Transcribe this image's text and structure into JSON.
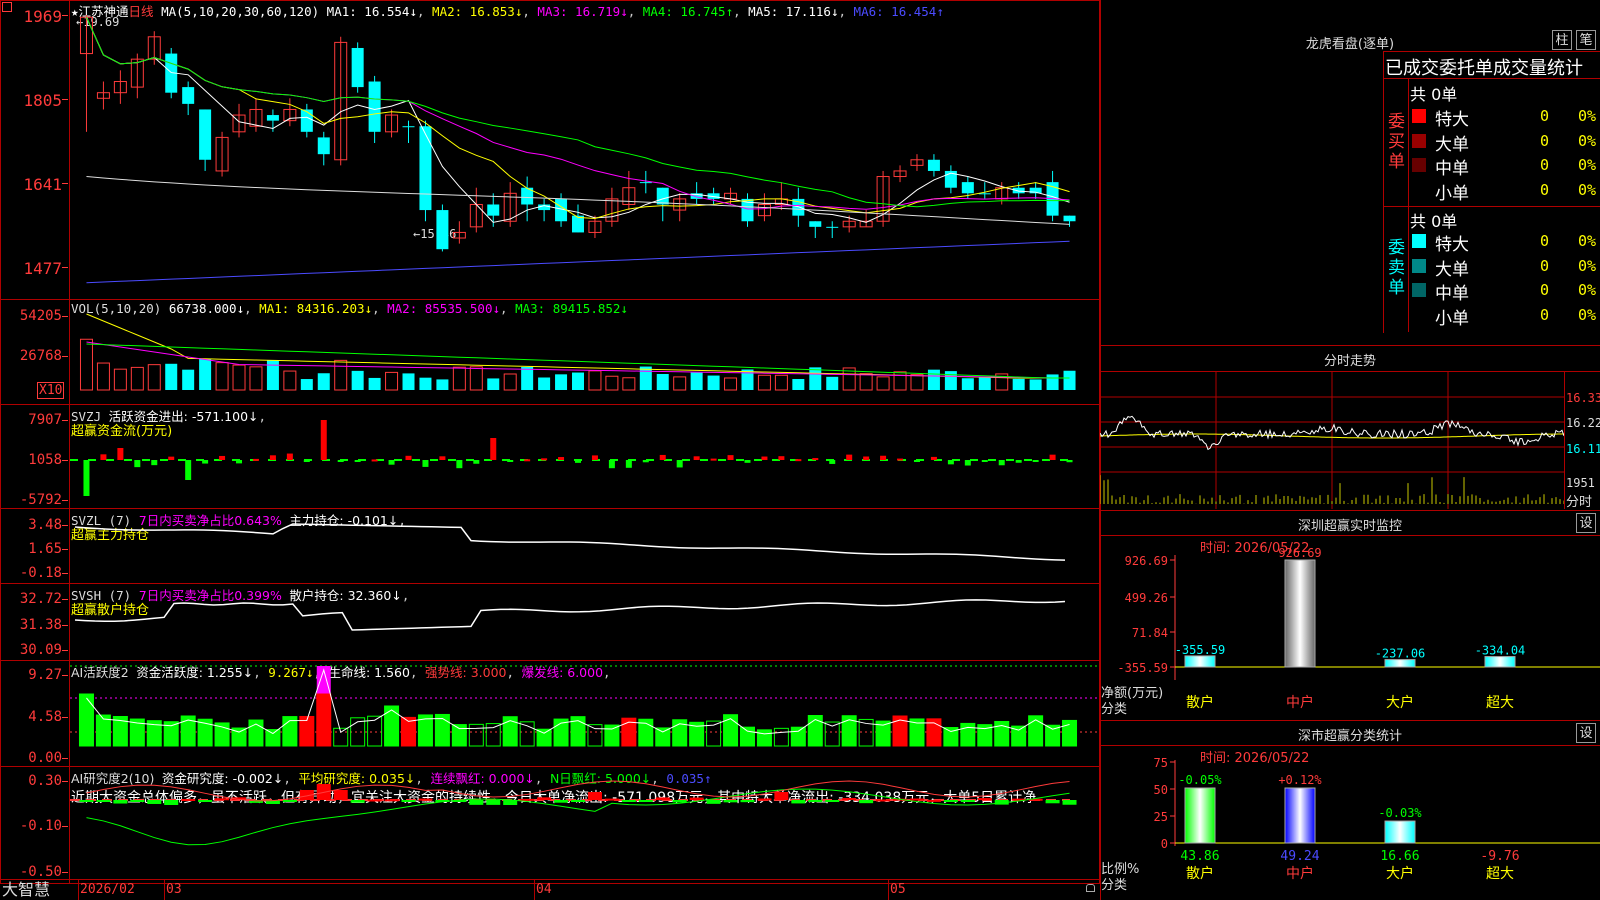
{
  "stock": {
    "star": "★",
    "name": "江苏神通",
    "period": "日线",
    "ma_header": "MA(5,10,20,30,60,120)",
    "ma": [
      {
        "label": "MA1: 16.554↓",
        "color": "#ffffff"
      },
      {
        "label": "MA2: 16.853↓",
        "color": "#ffff00"
      },
      {
        "label": "MA3: 16.719↓",
        "color": "#ff00ff"
      },
      {
        "label": "MA4: 16.745↑",
        "color": "#00ff00"
      },
      {
        "label": "MA5: 17.116↓",
        "color": "#ffffff"
      },
      {
        "label": "MA6: 16.454↑",
        "color": "#4b4bff"
      }
    ],
    "top_left_icon": "expand-icon",
    "high_mark": "←19.69",
    "low_mark": "←15.46"
  },
  "price_axis": [
    "1969",
    "1805",
    "1641",
    "1477"
  ],
  "vol": {
    "header": "VOL(5,10,20)",
    "value": "66738.000↓",
    "ma1": "MA1: 84316.203↓",
    "ma2": "MA2: 85535.500↓",
    "ma3": "MA3: 89415.852↓",
    "axis": [
      "54205",
      "26768"
    ],
    "unit": "X10"
  },
  "svzj": {
    "header": "SVZJ",
    "label": "活跃资金进出: -571.100↓",
    "sub": "超赢资金流(万元)",
    "axis": [
      "7907",
      "1058",
      "-5792"
    ]
  },
  "svzl": {
    "header": "SVZL (7)",
    "ratio": "7日内买卖净占比0.643%",
    "label": "主力持仓: -0.101↓",
    "sub": "超赢主力持仓",
    "axis": [
      "3.48",
      "1.65",
      "-0.18"
    ]
  },
  "svsh": {
    "header": "SVSH (7)",
    "ratio": "7日内买卖净占比0.399%",
    "label": "散户持仓: 32.360↓",
    "sub": "超赢散户持仓",
    "axis": [
      "32.72",
      "31.38",
      "30.09"
    ]
  },
  "ai1": {
    "header": "AI活跃度2",
    "label": "资金活跃度: 1.255↓",
    "v2": "9.267↓",
    "life": "生命线: 1.560",
    "strong": "强势线: 3.000",
    "burst": "爆发线: 6.000",
    "axis": [
      "9.27",
      "4.58",
      "0.00"
    ]
  },
  "ai2": {
    "header": "AI研究度2(10)",
    "label": "资金研究度: -0.002↓",
    "avg": "平均研究度: 0.035↓",
    "cont": "连续飘红: 0.000↓",
    "nday": "N日飘红: 5.000↓",
    "last": "0.035↑",
    "comment": "近期大资金总体偏多，虽不活跃，但有异动，宜关注大资金的持续性，今日大单净流出: -571.098万元，其中特大单净流出: -334.038万元，大单5日累计净",
    "axis": [
      "0.30",
      "-0.10",
      "-0.50"
    ]
  },
  "x_axis": {
    "brand": "大智慧",
    "labels": [
      "2026/02",
      "03",
      "04",
      "05"
    ],
    "lock_icon": "lock-icon"
  },
  "lhb": {
    "title": "龙虎看盘(逐单)",
    "btn1": "柱",
    "btn2": "笔",
    "headline": "已成交委托单成交量统计",
    "buy_total": "共 0单",
    "sell_total": "共 0单",
    "buy_side": "委买单",
    "sell_side": "委卖单",
    "buy_rows": [
      {
        "label": "特大",
        "num": "0",
        "pct": "0%",
        "color": "#ff0000"
      },
      {
        "label": "大单",
        "num": "0",
        "pct": "0%",
        "color": "#990000"
      },
      {
        "label": "中单",
        "num": "0",
        "pct": "0%",
        "color": "#660000"
      },
      {
        "label": "小单",
        "num": "0",
        "pct": "0%",
        "color": ""
      }
    ],
    "sell_rows": [
      {
        "label": "特大",
        "num": "0",
        "pct": "0%",
        "color": "#00ffff"
      },
      {
        "label": "大单",
        "num": "0",
        "pct": "0%",
        "color": "#008888"
      },
      {
        "label": "中单",
        "num": "0",
        "pct": "0%",
        "color": "#006666"
      },
      {
        "label": "小单",
        "num": "0",
        "pct": "0%",
        "color": ""
      }
    ]
  },
  "intraday": {
    "title": "分时走势",
    "price_labels": [
      "16.33",
      "16.22",
      "16.11"
    ],
    "vol_label": "1951",
    "bottom_label": "分时"
  },
  "monitor": {
    "title": "深圳超赢实时监控",
    "set": "设",
    "time": "时间: 2026/05/22",
    "axis": [
      "926.69",
      "499.26",
      "71.84",
      "-355.59"
    ],
    "ylabel": "净额(万元)",
    "xlabel": "分类",
    "cats": [
      "散户",
      "中户",
      "大户",
      "超大"
    ],
    "values": [
      "-355.59",
      "926.69",
      "-237.06",
      "-334.04"
    ]
  },
  "classify": {
    "title": "深市超赢分类统计",
    "set": "设",
    "time": "时间: 2026/05/22",
    "axis": [
      "75",
      "50",
      "25",
      "0"
    ],
    "ylabel": "比例%",
    "xlabel": "分类",
    "cats": [
      "散户",
      "中户",
      "大户",
      "超大"
    ],
    "changes": [
      "-0.05%",
      "+0.12%",
      "-0.03%",
      ""
    ],
    "values": [
      "43.86",
      "49.24",
      "16.66",
      "-9.76"
    ]
  },
  "chart_data": [
    {
      "type": "candlestick",
      "title": "江苏神通 日线",
      "ylim": [
        14.77,
        19.69
      ],
      "candles": [
        [
          19.0,
          19.65,
          17.6,
          19.69,
          "up"
        ],
        [
          18.2,
          18.3,
          18.0,
          18.5,
          "up"
        ],
        [
          18.3,
          18.5,
          18.1,
          18.7,
          "up"
        ],
        [
          18.4,
          18.9,
          18.2,
          19.0,
          "up"
        ],
        [
          18.9,
          19.3,
          18.8,
          19.4,
          "up"
        ],
        [
          19.0,
          18.3,
          18.2,
          19.1,
          "dn"
        ],
        [
          18.4,
          18.1,
          17.9,
          18.5,
          "dn"
        ],
        [
          18.0,
          17.1,
          16.9,
          18.0,
          "dn"
        ],
        [
          16.9,
          17.5,
          16.8,
          17.6,
          "up"
        ],
        [
          17.6,
          17.9,
          17.5,
          18.1,
          "up"
        ],
        [
          17.7,
          18.0,
          17.6,
          18.2,
          "up"
        ],
        [
          17.9,
          17.8,
          17.6,
          18.0,
          "dn"
        ],
        [
          17.8,
          18.0,
          17.7,
          18.2,
          "up"
        ],
        [
          18.0,
          17.6,
          17.5,
          18.1,
          "dn"
        ],
        [
          17.5,
          17.2,
          17.0,
          17.6,
          "dn"
        ],
        [
          17.1,
          19.2,
          17.0,
          19.3,
          "up"
        ],
        [
          19.1,
          18.4,
          18.3,
          19.2,
          "dn"
        ],
        [
          18.5,
          17.6,
          17.4,
          18.6,
          "dn"
        ],
        [
          17.6,
          17.9,
          17.5,
          18.0,
          "up"
        ],
        [
          17.7,
          17.7,
          17.4,
          17.8,
          "dn"
        ],
        [
          17.7,
          16.2,
          16.0,
          17.8,
          "dn"
        ],
        [
          16.2,
          15.5,
          15.46,
          16.3,
          "dn"
        ],
        [
          15.7,
          15.8,
          15.6,
          16.0,
          "up"
        ],
        [
          15.9,
          16.3,
          15.8,
          16.6,
          "up"
        ],
        [
          16.3,
          16.1,
          15.9,
          16.5,
          "dn"
        ],
        [
          16.0,
          16.5,
          15.9,
          16.7,
          "up"
        ],
        [
          16.6,
          16.3,
          16.0,
          16.8,
          "dn"
        ],
        [
          16.3,
          16.2,
          16.0,
          16.4,
          "dn"
        ],
        [
          16.4,
          16.0,
          15.9,
          16.5,
          "dn"
        ],
        [
          16.1,
          15.8,
          15.8,
          16.3,
          "dn"
        ],
        [
          15.8,
          16.0,
          15.7,
          16.1,
          "up"
        ],
        [
          16.0,
          16.4,
          15.9,
          16.6,
          "up"
        ],
        [
          16.3,
          16.6,
          16.2,
          16.9,
          "up"
        ],
        [
          16.7,
          16.7,
          16.5,
          16.9,
          "dn"
        ],
        [
          16.6,
          16.3,
          16.0,
          16.6,
          "dn"
        ],
        [
          16.2,
          16.4,
          16.0,
          16.5,
          "up"
        ],
        [
          16.5,
          16.4,
          16.3,
          16.7,
          "dn"
        ],
        [
          16.5,
          16.4,
          16.3,
          16.6,
          "dn"
        ],
        [
          16.4,
          16.5,
          16.3,
          16.6,
          "up"
        ],
        [
          16.4,
          16.0,
          15.9,
          16.5,
          "dn"
        ],
        [
          16.1,
          16.3,
          16.0,
          16.5,
          "up"
        ],
        [
          16.3,
          16.4,
          16.2,
          16.7,
          "up"
        ],
        [
          16.4,
          16.1,
          15.9,
          16.6,
          "dn"
        ],
        [
          16.0,
          15.9,
          15.7,
          16.0,
          "dn"
        ],
        [
          15.9,
          15.9,
          15.7,
          16.0,
          "dn"
        ],
        [
          15.9,
          16.0,
          15.8,
          16.1,
          "up"
        ],
        [
          15.9,
          16.0,
          15.9,
          16.2,
          "up"
        ],
        [
          16.0,
          16.8,
          15.9,
          16.9,
          "up"
        ],
        [
          16.8,
          16.9,
          16.7,
          17.0,
          "up"
        ],
        [
          17.0,
          17.1,
          16.9,
          17.2,
          "up"
        ],
        [
          17.1,
          16.9,
          16.8,
          17.2,
          "dn"
        ],
        [
          16.9,
          16.6,
          16.5,
          17.0,
          "dn"
        ],
        [
          16.7,
          16.5,
          16.4,
          16.8,
          "dn"
        ],
        [
          16.5,
          16.5,
          16.4,
          16.7,
          "dn"
        ],
        [
          16.4,
          16.6,
          16.3,
          16.7,
          "up"
        ],
        [
          16.6,
          16.5,
          16.4,
          16.7,
          "dn"
        ],
        [
          16.6,
          16.5,
          16.4,
          16.7,
          "dn"
        ],
        [
          16.7,
          16.1,
          16.0,
          16.9,
          "dn"
        ],
        [
          16.1,
          16.0,
          15.9,
          16.1,
          "dn"
        ]
      ]
    }
  ]
}
